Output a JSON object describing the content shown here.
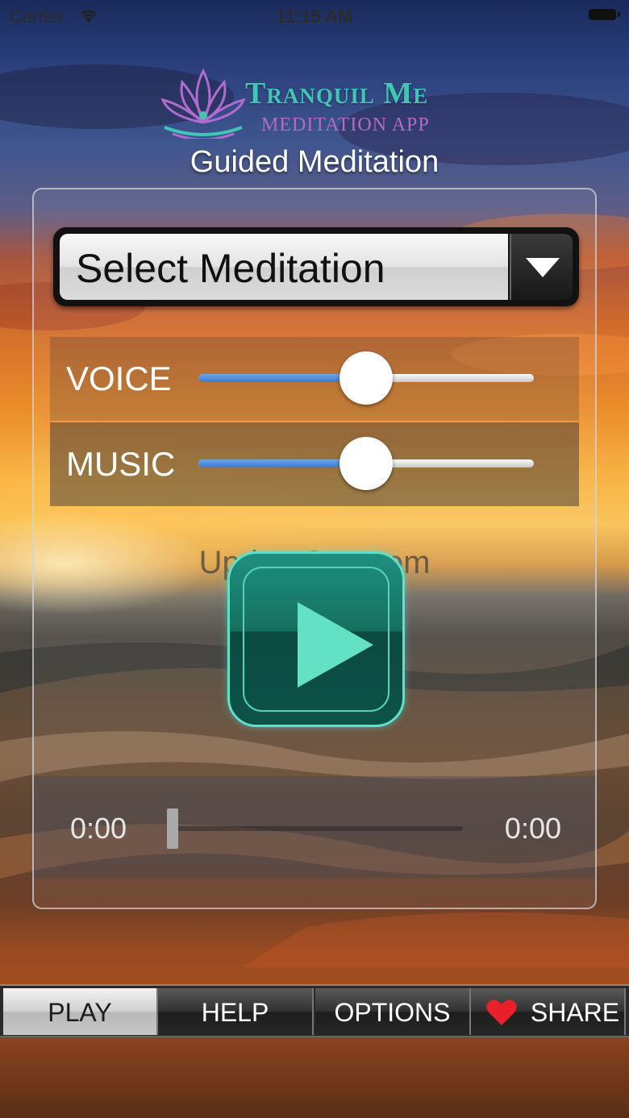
{
  "status_bar": {
    "carrier": "Carrier",
    "time": "11:15 AM"
  },
  "logo": {
    "title": "Tranquil Me",
    "subtitle": "MEDITATION APP"
  },
  "heading": "Guided Meditation",
  "select": {
    "label": "Select Meditation"
  },
  "sliders": {
    "voice": {
      "label": "VOICE",
      "value_fraction": 0.5
    },
    "music": {
      "label": "MUSIC",
      "value_fraction": 0.5
    }
  },
  "watermark": "UpdateStar.com",
  "progress": {
    "elapsed": "0:00",
    "remaining": "0:00",
    "value_fraction": 0
  },
  "tabs": [
    {
      "label": "PLAY",
      "active": true
    },
    {
      "label": "HELP",
      "active": false
    },
    {
      "label": "OPTIONS",
      "active": false
    },
    {
      "label": "SHARE",
      "active": false,
      "icon": "heart-icon"
    }
  ],
  "colors": {
    "accent": "#3fc7b3",
    "play_button": "#16705f",
    "heart": "#e8202a",
    "slider_fill": "#3d7bc9"
  }
}
